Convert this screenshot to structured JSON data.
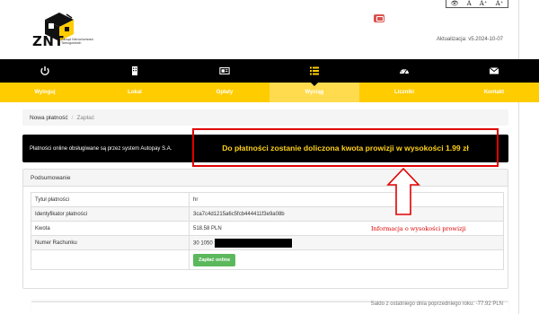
{
  "header": {
    "logo_text": "ZNT",
    "logo_sub": "Zarząd Nieruchomości Tarnogórskich",
    "update_label": "Aktualizacja: v5.2024-10-07",
    "a11y": [
      "👁",
      "A",
      "A⁺",
      "A⁺"
    ]
  },
  "nav": {
    "items": [
      {
        "label": "Wyloguj",
        "icon": "power-icon"
      },
      {
        "label": "Lokal",
        "icon": "building-icon"
      },
      {
        "label": "Opłaty",
        "icon": "bill-icon"
      },
      {
        "label": "Wyciąg",
        "icon": "list-icon",
        "active": true
      },
      {
        "label": "Liczniki",
        "icon": "gauge-icon"
      },
      {
        "label": "Kontakt",
        "icon": "envelope-icon"
      }
    ]
  },
  "breadcrumb": {
    "first": "Nowa płatność",
    "sep": "/",
    "current": "Zapłać"
  },
  "banner": {
    "text": "Płatności online obsługiwane są przez system Autopay S.A.",
    "highlight": "Do płatności zostanie doliczona kwota prowizji w wysokości 1.99 zł"
  },
  "summary": {
    "title": "Podsumowanie",
    "rows": [
      {
        "label": "Tytuł płatności",
        "value": "hr"
      },
      {
        "label": "Identyfikator płatności",
        "value": "3ca7c4d1215a6c5fcb444411f3e9a08b"
      },
      {
        "label": "Kwota",
        "value": "518.58 PLN"
      },
      {
        "label": "Numer Rachunku",
        "value": "30 1050"
      }
    ],
    "pay_button": "Zapłać online"
  },
  "annotation": "Informacja o wysokości prowizji",
  "footer_text": "Saldo z ostatniego dnia poprzedniego roku: -77.92 PLN"
}
